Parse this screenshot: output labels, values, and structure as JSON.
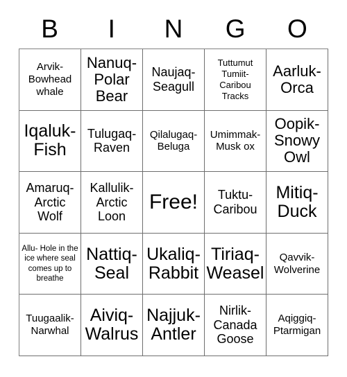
{
  "card": {
    "title": "BINGO",
    "header_letters": [
      "B",
      "I",
      "N",
      "G",
      "O"
    ],
    "free_space_label": "Free!",
    "colors": {
      "text": "#000000",
      "grid_line": "#6e6e6e",
      "background": "#ffffff"
    },
    "rows": [
      [
        {
          "text": "Arvik- Bowhead whale",
          "size": "s"
        },
        {
          "text": "Nanuq- Polar Bear",
          "size": "l"
        },
        {
          "text": "Naujaq- Seagull",
          "size": "m"
        },
        {
          "text": "Tuttumut Tumiit- Caribou Tracks",
          "size": "xs"
        },
        {
          "text": "Aarluk- Orca",
          "size": "l"
        }
      ],
      [
        {
          "text": "Iqaluk- Fish",
          "size": "xl"
        },
        {
          "text": "Tulugaq- Raven",
          "size": "m"
        },
        {
          "text": "Qilalugaq- Beluga",
          "size": "s"
        },
        {
          "text": "Umimmak- Musk ox",
          "size": "s"
        },
        {
          "text": "Oopik- Snowy Owl",
          "size": "l"
        }
      ],
      [
        {
          "text": "Amaruq- Arctic Wolf",
          "size": "m"
        },
        {
          "text": "Kallulik- Arctic Loon",
          "size": "m"
        },
        {
          "text": "Free!",
          "size": "xxl"
        },
        {
          "text": "Tuktu- Caribou",
          "size": "m"
        },
        {
          "text": "Mitiq- Duck",
          "size": "xl"
        }
      ],
      [
        {
          "text": "Allu- Hole in the ice where seal comes up to breathe",
          "size": "xxs"
        },
        {
          "text": "Nattiq- Seal",
          "size": "xl"
        },
        {
          "text": "Ukaliq- Rabbit",
          "size": "xl"
        },
        {
          "text": "Tiriaq- Weasel",
          "size": "xl"
        },
        {
          "text": "Qavvik- Wolverine",
          "size": "s"
        }
      ],
      [
        {
          "text": "Tuugaalik- Narwhal",
          "size": "s"
        },
        {
          "text": "Aiviq- Walrus",
          "size": "xl"
        },
        {
          "text": "Najjuk- Antler",
          "size": "xl"
        },
        {
          "text": "Nirlik- Canada Goose",
          "size": "m"
        },
        {
          "text": "Aqiggiq- Ptarmigan",
          "size": "s"
        }
      ]
    ]
  }
}
